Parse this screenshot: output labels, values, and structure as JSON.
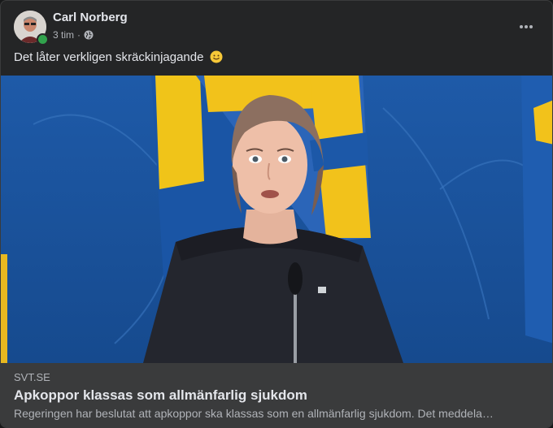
{
  "post": {
    "author": "Carl Norberg",
    "time": "3 tim",
    "audience_icon": "globe-icon",
    "text": "Det låter verkligen skräckinjagande",
    "emoji": "slightly-smiling-face-icon",
    "more_icon": "more-options-icon"
  },
  "link_preview": {
    "domain": "SVT.SE",
    "title": "Apkoppor klassas som allmänfarlig sjukdom",
    "description": "Regeringen har beslutat att apkoppor ska klassas som en allmänfarlig sjukdom. Det meddela…"
  },
  "colors": {
    "card_bg": "#242526",
    "link_bg": "#3a3b3c",
    "text_primary": "#e4e6eb",
    "text_secondary": "#b0b3b8",
    "online": "#31a24c",
    "photo_blue": "#1d56a3",
    "flag_yellow": "#f2c21b"
  }
}
